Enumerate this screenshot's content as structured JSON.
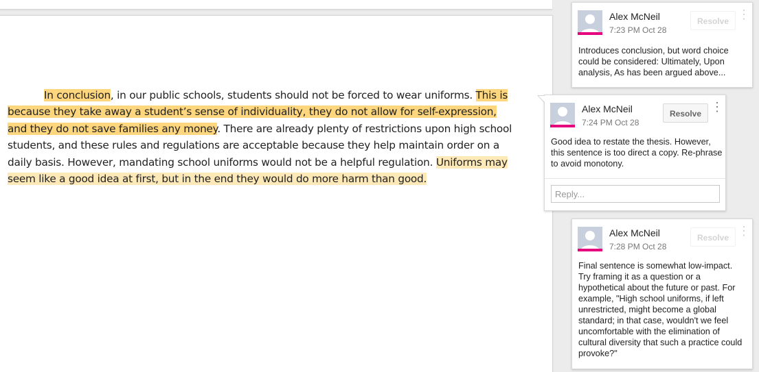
{
  "document": {
    "segments": [
      {
        "text": "In conclusion",
        "style": "strong"
      },
      {
        "text": ", in our public schools, students should not be forced to wear uniforms. ",
        "style": "none"
      },
      {
        "text": "This is because they take away a student’s sense of individuality, they do not allow for self-expression, and they do not save families any money",
        "style": "strong"
      },
      {
        "text": ". There are already plenty of restrictions upon high school students, and these rules and regulations are acceptable because they help maintain order on a daily basis. However, mandating school uniforms would not be a helpful regulation. ",
        "style": "none"
      },
      {
        "text": "Uniforms may seem like a good idea at first, but in the end they would do more harm than good.",
        "style": "light"
      }
    ]
  },
  "comments": [
    {
      "author": "Alex McNeil",
      "time": "7:23 PM Oct 28",
      "resolve_label": "Resolve",
      "more_glyph": "⋮",
      "body": "Introduces conclusion, but word choice could be considered: Ultimately, Upon analysis, As has been argued above..."
    },
    {
      "author": "Alex McNeil",
      "time": "7:24 PM Oct 28",
      "resolve_label": "Resolve",
      "more_glyph": "⋮",
      "body": "Good idea to restate the thesis. However, this sentence is too direct a copy. Re-phrase to avoid monotony.",
      "reply_placeholder": "Reply..."
    },
    {
      "author": "Alex McNeil",
      "time": "7:28 PM Oct 28",
      "resolve_label": "Resolve",
      "more_glyph": "⋮",
      "body": "Final sentence is somewhat low-impact. Try framing it as a question or a hypothetical about the future or past. For example, \"High school uniforms, if left unrestricted, might become a global standard; in that case, wouldn't we feel uncomfortable with the elimination of cultural diversity that such a practice could provoke?\""
    }
  ],
  "colors": {
    "highlight_strong": "#fdd67d",
    "highlight_light": "#fde9b8",
    "avatar_accent": "#e5007d"
  },
  "icons": {
    "avatar": "default-user-avatar-icon",
    "more": "more-vertical-icon"
  }
}
